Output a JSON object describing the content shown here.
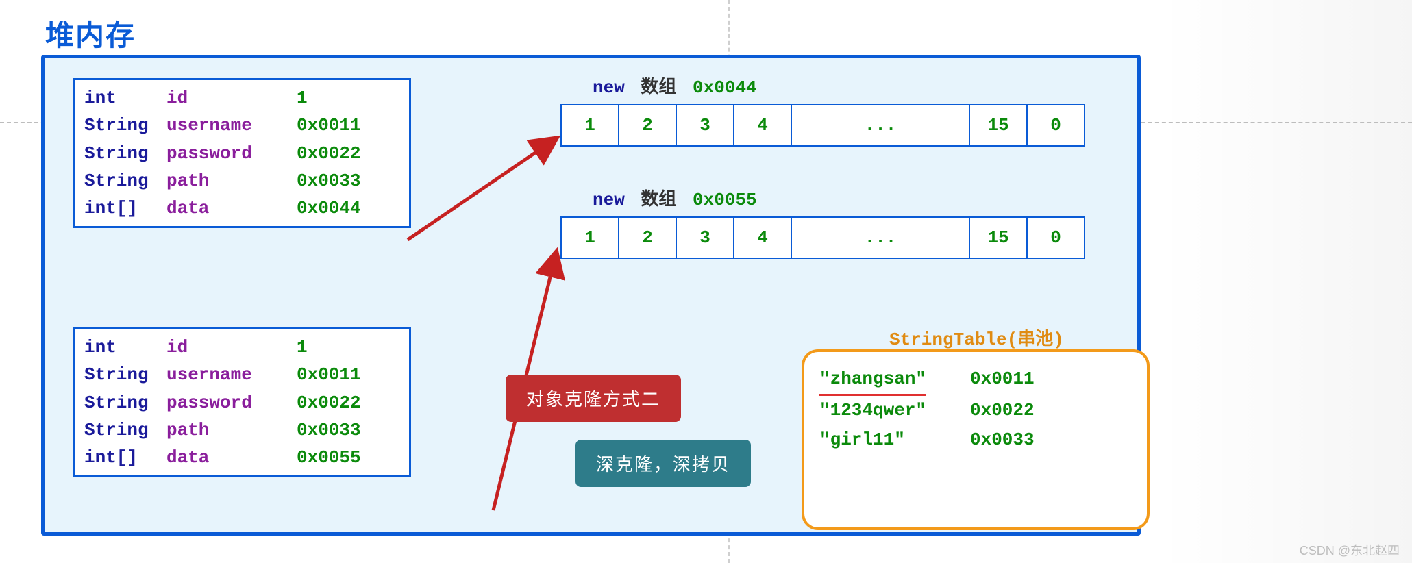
{
  "title": "堆内存",
  "watermark": "CSDN @东北赵四",
  "obj1": {
    "rows": [
      {
        "type": "int",
        "name": "id",
        "val": "1"
      },
      {
        "type": "String",
        "name": "username",
        "val": "0x0011"
      },
      {
        "type": "String",
        "name": "password",
        "val": "0x0022"
      },
      {
        "type": "String",
        "name": "path",
        "val": "0x0033"
      },
      {
        "type": "int[]",
        "name": "data",
        "val": "0x0044"
      }
    ]
  },
  "obj2": {
    "rows": [
      {
        "type": "int",
        "name": "id",
        "val": "1"
      },
      {
        "type": "String",
        "name": "username",
        "val": "0x0011"
      },
      {
        "type": "String",
        "name": "password",
        "val": "0x0022"
      },
      {
        "type": "String",
        "name": "path",
        "val": "0x0033"
      },
      {
        "type": "int[]",
        "name": "data",
        "val": "0x0055"
      }
    ]
  },
  "arr1": {
    "kw": "new",
    "zh": "数组",
    "addr": "0x0044",
    "cells": [
      "1",
      "2",
      "3",
      "4",
      "...",
      "15",
      "0"
    ]
  },
  "arr2": {
    "kw": "new",
    "zh": "数组",
    "addr": "0x0055",
    "cells": [
      "1",
      "2",
      "3",
      "4",
      "...",
      "15",
      "0"
    ]
  },
  "callouts": {
    "red": "对象克隆方式二",
    "teal": "深克隆，深拷贝"
  },
  "pool": {
    "title": "StringTable(串池)",
    "rows": [
      {
        "s": "\"zhangsan\"",
        "a": "0x0011",
        "squiggle": true
      },
      {
        "s": "\"1234qwer\"",
        "a": "0x0022",
        "squiggle": false
      },
      {
        "s": "\"girl11\"",
        "a": "0x0033",
        "squiggle": false
      }
    ]
  }
}
